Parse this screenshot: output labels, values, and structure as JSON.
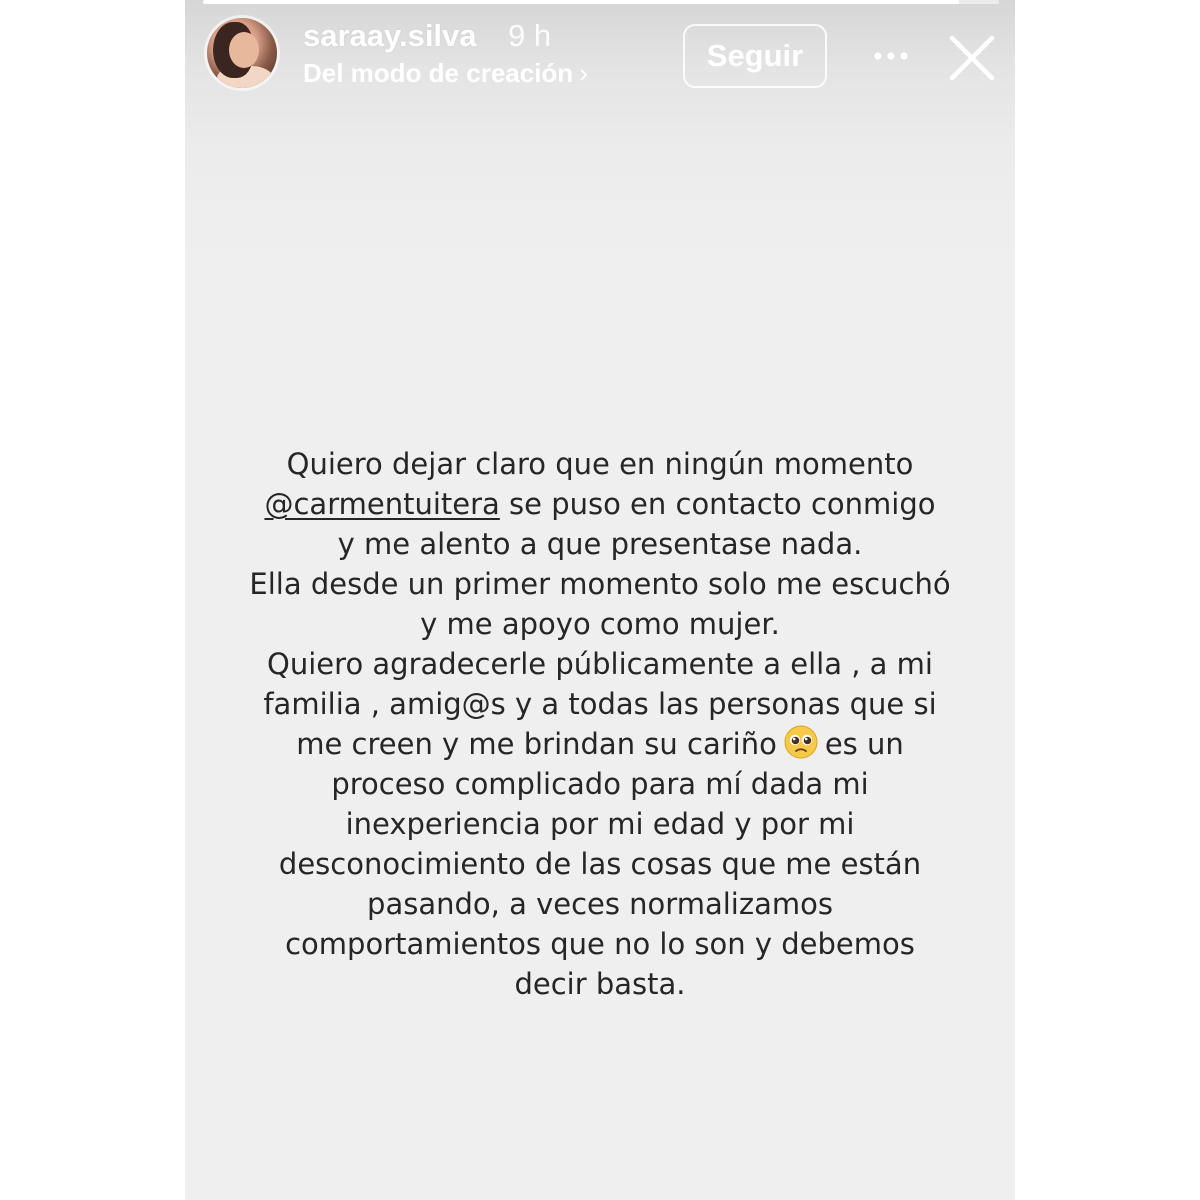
{
  "story": {
    "progress": 0.95,
    "header": {
      "username": "saraay.silva",
      "time_ago": "9 h",
      "subtitle": "Del modo de creación",
      "subtitle_chevron": "›",
      "follow_label": "Seguir",
      "more_icon": "more-dots-icon",
      "close_icon": "close-icon"
    },
    "text": {
      "line1": "Quiero dejar claro que en ningún momento",
      "mention": "@carmentuitera",
      "line2_rest": " se puso en contacto conmigo",
      "line3": "y me alento a que presentase nada.",
      "line4": "Ella desde un primer momento solo me escuchó",
      "line5": "y me apoyo como mujer.",
      "line6": "Quiero agradecerle públicamente a ella , a mi",
      "line7": "familia , amig@s y a todas las personas que si",
      "line8_before": "me creen y me brindan su cariño",
      "line8_after": "es un",
      "line9": "proceso complicado para mí dada mi",
      "line10": "inexperiencia por mi edad y por mi",
      "line11": "desconocimiento de las cosas que me están",
      "line12": "pasando, a veces normalizamos",
      "line13": "comportamientos que no lo son y debemos",
      "line14": "decir basta.",
      "emoji": "pleading-face-emoji"
    }
  },
  "colors": {
    "background": "#efefef",
    "text": "#262626",
    "header_text": "#ffffff"
  }
}
